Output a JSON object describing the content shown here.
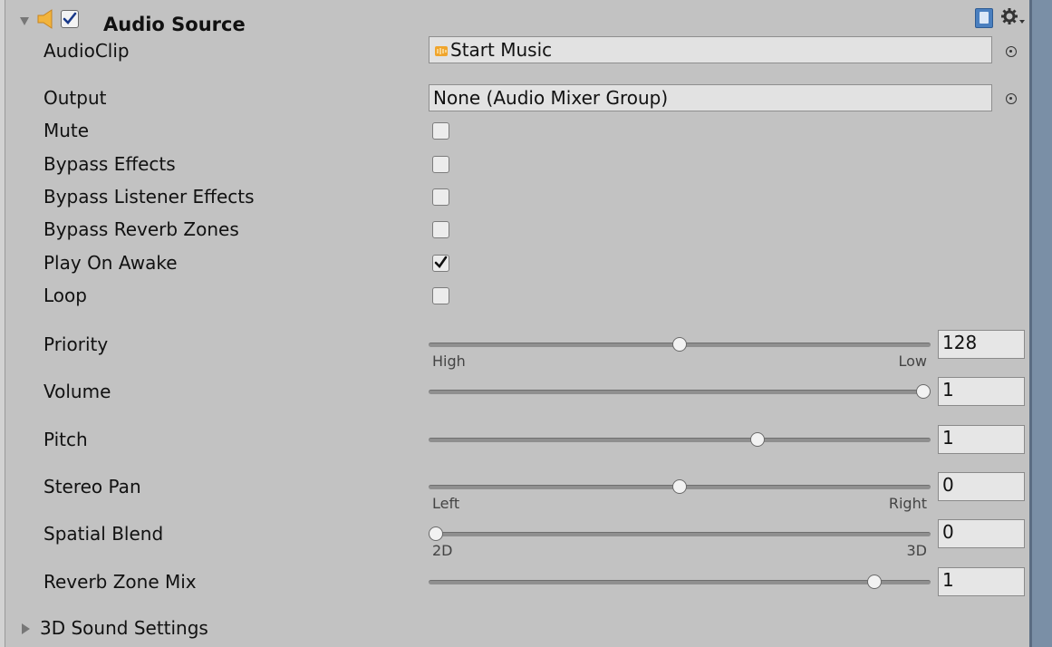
{
  "component": {
    "title": "Audio Source",
    "enabled": true,
    "expanded": true
  },
  "fields": {
    "audio_clip": {
      "label": "AudioClip",
      "value": "Start Music"
    },
    "output": {
      "label": "Output",
      "value": "None (Audio Mixer Group)"
    }
  },
  "toggles": [
    {
      "label": "Mute",
      "checked": false
    },
    {
      "label": "Bypass Effects",
      "checked": false
    },
    {
      "label": "Bypass Listener Effects",
      "checked": false
    },
    {
      "label": "Bypass Reverb Zones",
      "checked": false
    },
    {
      "label": "Play On Awake",
      "checked": true
    },
    {
      "label": "Loop",
      "checked": false
    }
  ],
  "sliders": [
    {
      "label": "Priority",
      "value": "128",
      "fraction": 0.5,
      "min_caption": "High",
      "max_caption": "Low"
    },
    {
      "label": "Volume",
      "value": "1",
      "fraction": 1.0,
      "min_caption": "",
      "max_caption": ""
    },
    {
      "label": "Pitch",
      "value": "1",
      "fraction": 0.66,
      "min_caption": "",
      "max_caption": ""
    },
    {
      "label": "Stereo Pan",
      "value": "0",
      "fraction": 0.5,
      "min_caption": "Left",
      "max_caption": "Right"
    },
    {
      "label": "Spatial Blend",
      "value": "0",
      "fraction": 0.0,
      "min_caption": "2D",
      "max_caption": "3D"
    },
    {
      "label": "Reverb Zone Mix",
      "value": "1",
      "fraction": 0.9,
      "min_caption": "",
      "max_caption": ""
    }
  ],
  "sound_settings": {
    "label": "3D Sound Settings",
    "expanded": false
  },
  "icons": {
    "header": [
      "foldout-arrow-icon",
      "speaker-icon",
      "checkbox-icon",
      "help-book-icon",
      "gear-icon"
    ],
    "clip": "audio-clip-icon",
    "target": "object-picker-icon"
  },
  "colors": {
    "background": "#c2c2c2",
    "field": "#e2e2e2",
    "speaker": "#f2b43c",
    "help_icon": "#4a7fbf"
  }
}
